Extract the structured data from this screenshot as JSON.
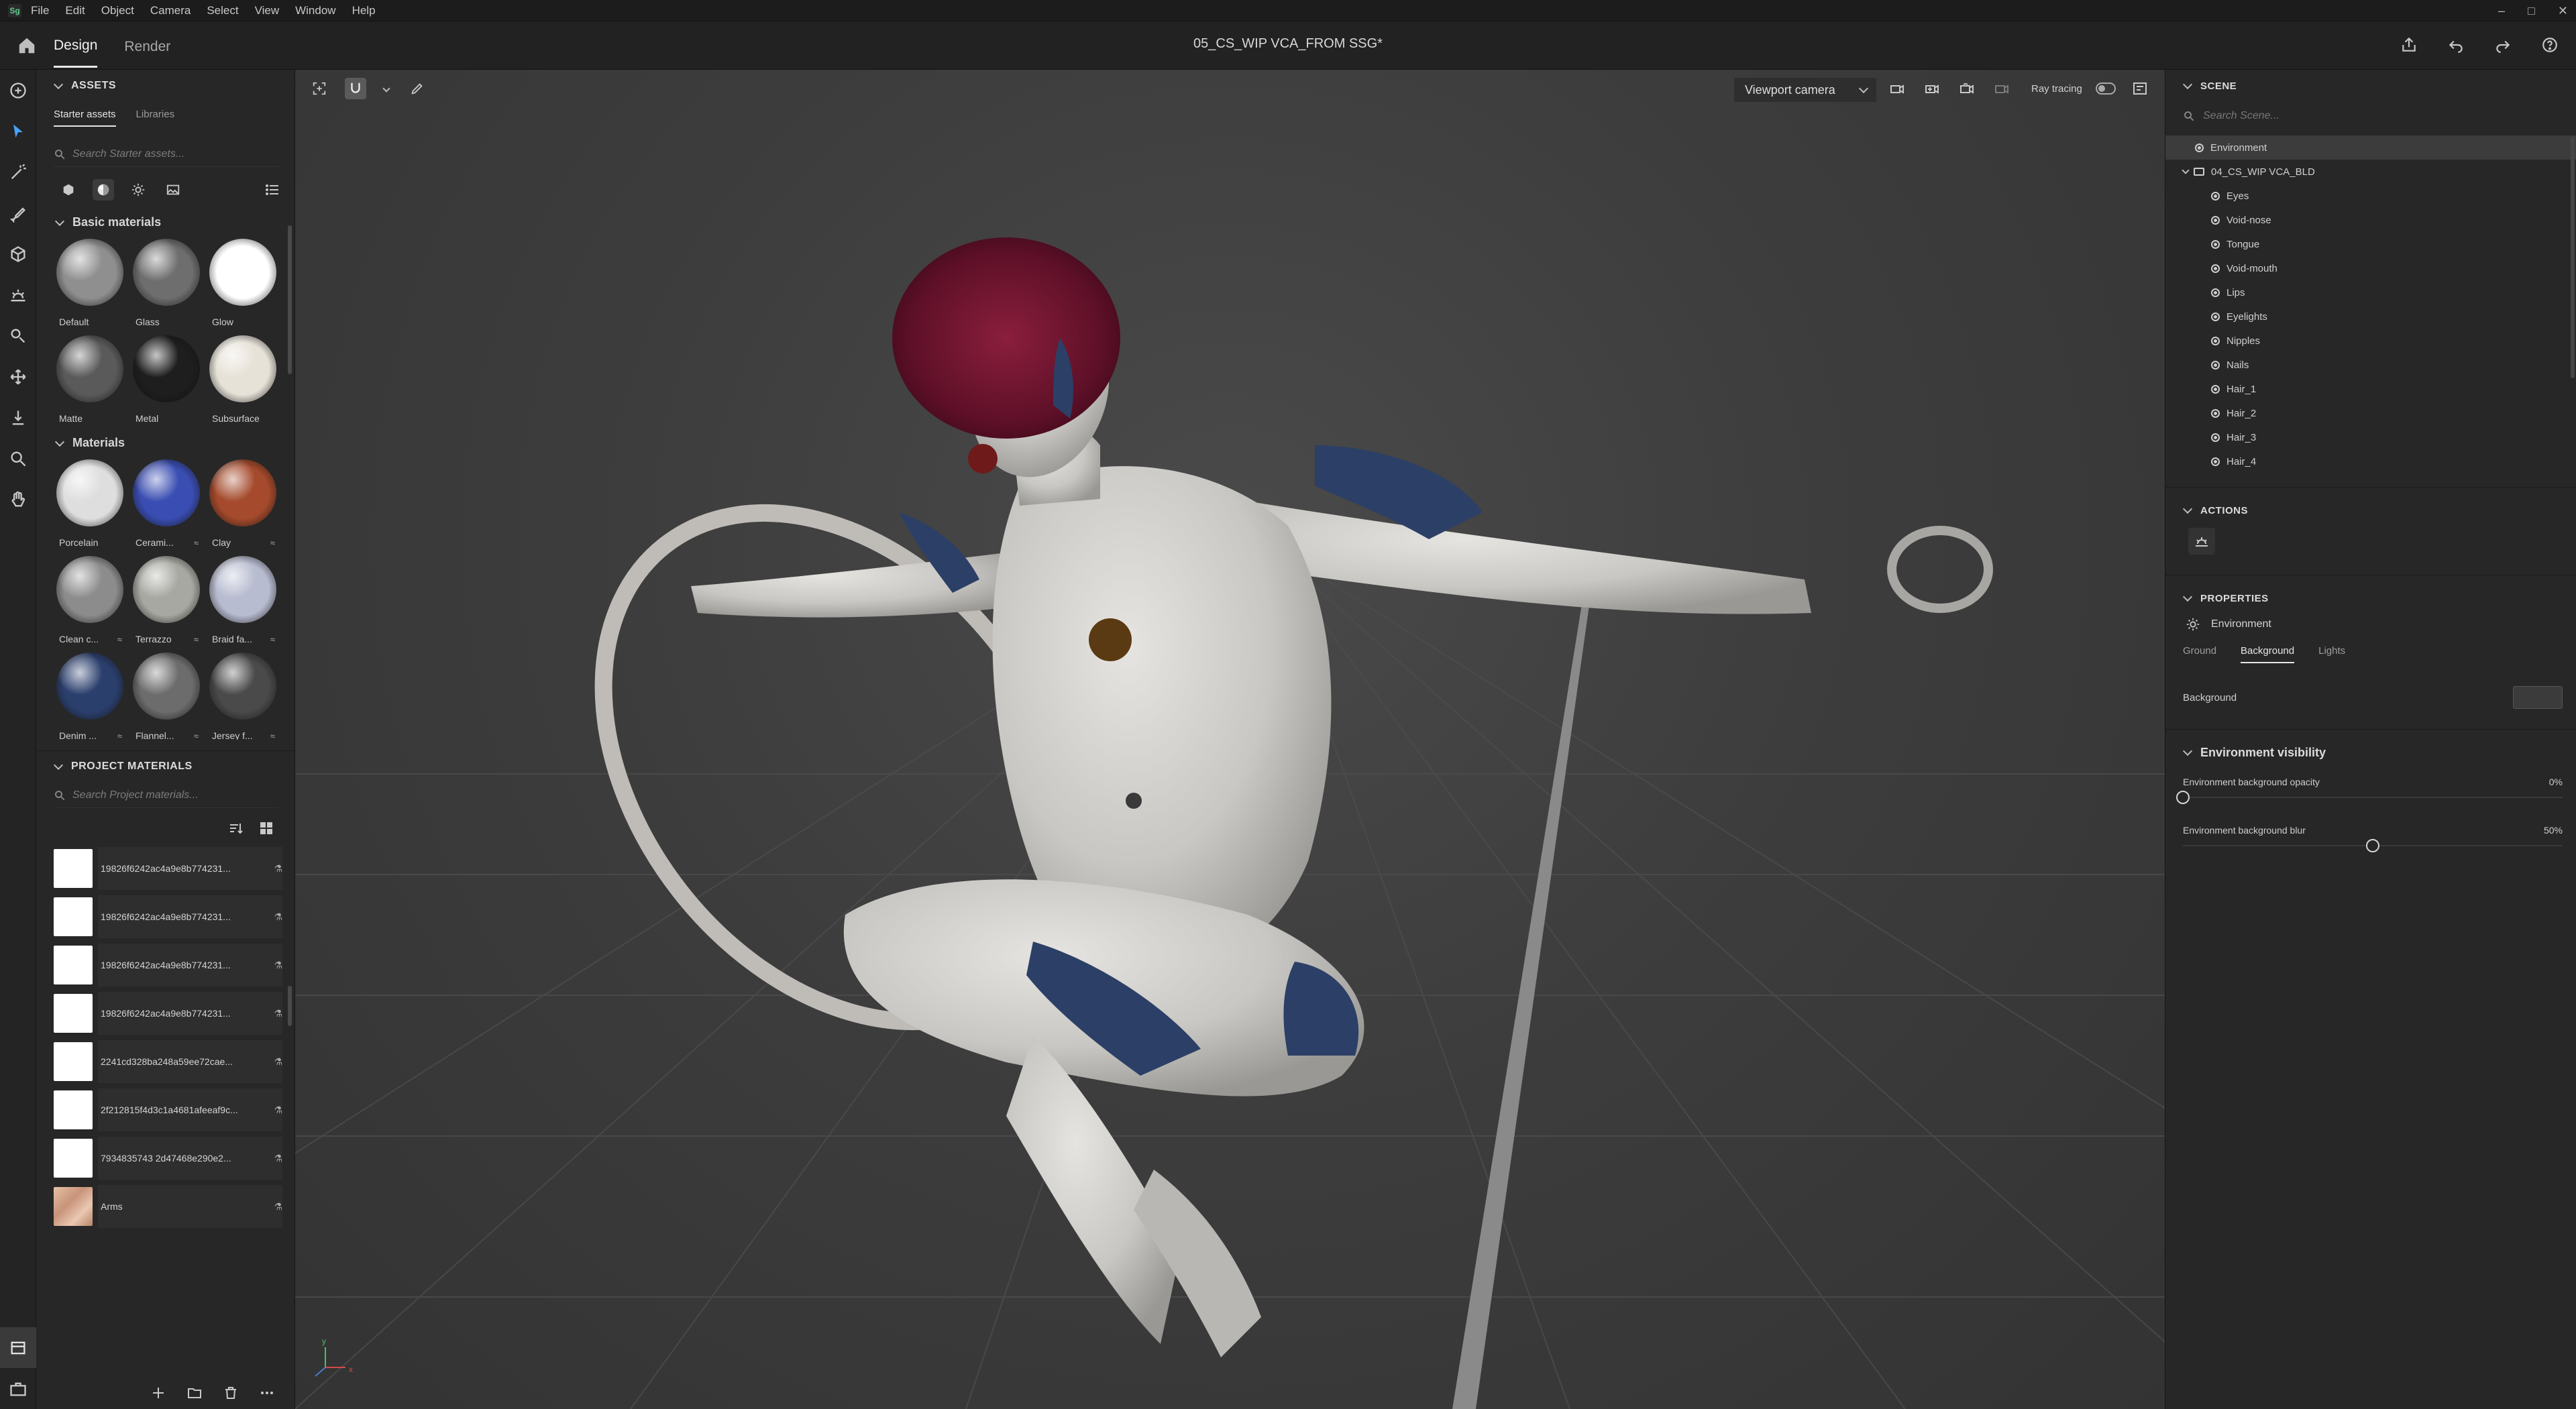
{
  "menu": {
    "logo_text": "Sg",
    "items": [
      "File",
      "Edit",
      "Object",
      "Camera",
      "Select",
      "View",
      "Window",
      "Help"
    ]
  },
  "header": {
    "tabs": [
      {
        "label": "Design",
        "active": true
      },
      {
        "label": "Render",
        "active": false
      }
    ],
    "document_title": "05_CS_WIP VCA_FROM SSG*"
  },
  "assets": {
    "heading": "ASSETS",
    "subtabs": [
      {
        "label": "Starter assets",
        "active": true
      },
      {
        "label": "Libraries",
        "active": false
      }
    ],
    "search_placeholder": "Search Starter assets...",
    "basic_materials_title": "Basic materials",
    "basic_materials": [
      {
        "label": "Default",
        "color": "#8f8f8f"
      },
      {
        "label": "Glass",
        "color": "#6e6e6e"
      },
      {
        "label": "Glow",
        "color": "#ffffff"
      },
      {
        "label": "Matte",
        "color": "#5a5a5a"
      },
      {
        "label": "Metal",
        "color": "#1e1e1e"
      },
      {
        "label": "Subsurface",
        "color": "#e7e2d8"
      }
    ],
    "materials_title": "Materials",
    "materials": [
      {
        "label": "Porcelain",
        "color": "#dedede",
        "linked": false
      },
      {
        "label": "Cerami...",
        "color": "#3a4db2",
        "linked": true
      },
      {
        "label": "Clay",
        "color": "#a54a2c",
        "linked": true
      },
      {
        "label": "Clean c...",
        "color": "#8c8c8c",
        "linked": true
      },
      {
        "label": "Terrazzo",
        "color": "#a8a8a2",
        "linked": true
      },
      {
        "label": "Braid fa...",
        "color": "#b8bcd0",
        "linked": true
      },
      {
        "label": "Denim ...",
        "color": "#2b3f6d",
        "linked": true
      },
      {
        "label": "Flannel...",
        "color": "#6c6c6c",
        "linked": true
      },
      {
        "label": "Jersey f...",
        "color": "#4a4a4a",
        "linked": true
      },
      {
        "label": "",
        "color": "#252525",
        "linked": false
      },
      {
        "label": "",
        "color": "#7f9bd0",
        "linked": false
      },
      {
        "label": "",
        "color": "#c0121c",
        "linked": false
      }
    ],
    "project_heading": "PROJECT MATERIALS",
    "project_search_placeholder": "Search Project materials...",
    "project_materials": [
      {
        "name": "19826f6242ac4a9e8b774231...",
        "thumb": "white"
      },
      {
        "name": "19826f6242ac4a9e8b774231...",
        "thumb": "white"
      },
      {
        "name": "19826f6242ac4a9e8b774231...",
        "thumb": "white"
      },
      {
        "name": "19826f6242ac4a9e8b774231...",
        "thumb": "white"
      },
      {
        "name": "2241cd328ba248a59ee72cae...",
        "thumb": "white"
      },
      {
        "name": "2f212815f4d3c1a4681afeeaf9c...",
        "thumb": "white"
      },
      {
        "name": "7934835743 2d47468e290e2...",
        "thumb": "white"
      },
      {
        "name": "Arms",
        "thumb": "skin"
      }
    ]
  },
  "viewport": {
    "camera_label": "Viewport camera",
    "ray_tracing_label": "Ray tracing",
    "ray_tracing_on": false,
    "axis_labels": {
      "x": "x",
      "y": "y"
    }
  },
  "scene": {
    "heading": "SCENE",
    "search_placeholder": "Search Scene...",
    "tree": [
      {
        "label": "Environment",
        "type": "env",
        "selected": true,
        "depth": 0
      },
      {
        "label": "04_CS_WIP VCA_BLD",
        "type": "folder",
        "selected": false,
        "depth": 0
      },
      {
        "label": "Eyes",
        "type": "mesh",
        "depth": 1
      },
      {
        "label": "Void-nose",
        "type": "mesh",
        "depth": 1
      },
      {
        "label": "Tongue",
        "type": "mesh",
        "depth": 1
      },
      {
        "label": "Void-mouth",
        "type": "mesh",
        "depth": 1
      },
      {
        "label": "Lips",
        "type": "mesh",
        "depth": 1
      },
      {
        "label": "Eyelights",
        "type": "mesh",
        "depth": 1
      },
      {
        "label": "Nipples",
        "type": "mesh",
        "depth": 1
      },
      {
        "label": "Nails",
        "type": "mesh",
        "depth": 1
      },
      {
        "label": "Hair_1",
        "type": "mesh",
        "depth": 1
      },
      {
        "label": "Hair_2",
        "type": "mesh",
        "depth": 1
      },
      {
        "label": "Hair_3",
        "type": "mesh",
        "depth": 1
      },
      {
        "label": "Hair_4",
        "type": "mesh",
        "depth": 1
      }
    ]
  },
  "actions": {
    "heading": "ACTIONS"
  },
  "properties": {
    "heading": "PROPERTIES",
    "object_label": "Environment",
    "tabs": [
      {
        "label": "Ground",
        "active": false
      },
      {
        "label": "Background",
        "active": true
      },
      {
        "label": "Lights",
        "active": false
      }
    ],
    "background_label": "Background",
    "background_color": "#3b3b3b",
    "visibility_title": "Environment visibility",
    "opacity_label": "Environment background opacity",
    "opacity_value": "0%",
    "opacity_fraction": 0,
    "blur_label": "Environment background blur",
    "blur_value": "50%",
    "blur_fraction": 0.5
  }
}
